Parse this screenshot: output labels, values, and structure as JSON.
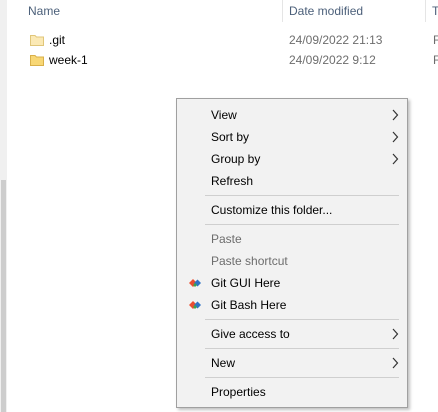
{
  "columns": {
    "name": "Name",
    "date_modified": "Date modified",
    "type": "T"
  },
  "files": [
    {
      "name": ".git",
      "date": "24/09/2022 21:13",
      "type": "F",
      "icon": "folder-light-icon"
    },
    {
      "name": "week-1",
      "date": "24/09/2022 9:12",
      "type": "F",
      "icon": "folder-icon"
    }
  ],
  "context_menu": {
    "view": "View",
    "sort_by": "Sort by",
    "group_by": "Group by",
    "refresh": "Refresh",
    "customize": "Customize this folder...",
    "paste": "Paste",
    "paste_shortcut": "Paste shortcut",
    "git_gui": "Git GUI Here",
    "git_bash": "Git Bash Here",
    "give_access": "Give access to",
    "new": "New",
    "properties": "Properties"
  },
  "colors": {
    "folder": "#f8d775",
    "folder_light": "#fbe9b5",
    "git_red": "#e94e31",
    "git_blue": "#2f73c4",
    "git_green": "#3fa34d"
  }
}
